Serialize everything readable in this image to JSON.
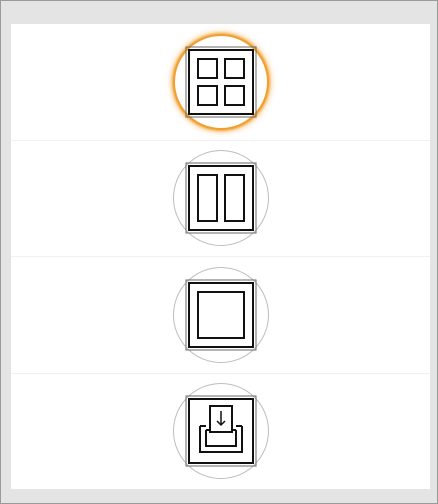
{
  "window": {
    "title": "",
    "background": "#e4e4e4",
    "frame_border": "#9a9a9a"
  },
  "layout_options": {
    "selected_index": 0,
    "accent_color": "#f0a030",
    "items": [
      {
        "name": "grid-2x2",
        "icon": "grid-2x2-icon",
        "selected": true
      },
      {
        "name": "split-2-columns",
        "icon": "two-column-icon",
        "selected": false
      },
      {
        "name": "single-pane",
        "icon": "single-pane-icon",
        "selected": false
      },
      {
        "name": "import-tray",
        "icon": "tray-download-icon",
        "selected": false
      }
    ]
  }
}
